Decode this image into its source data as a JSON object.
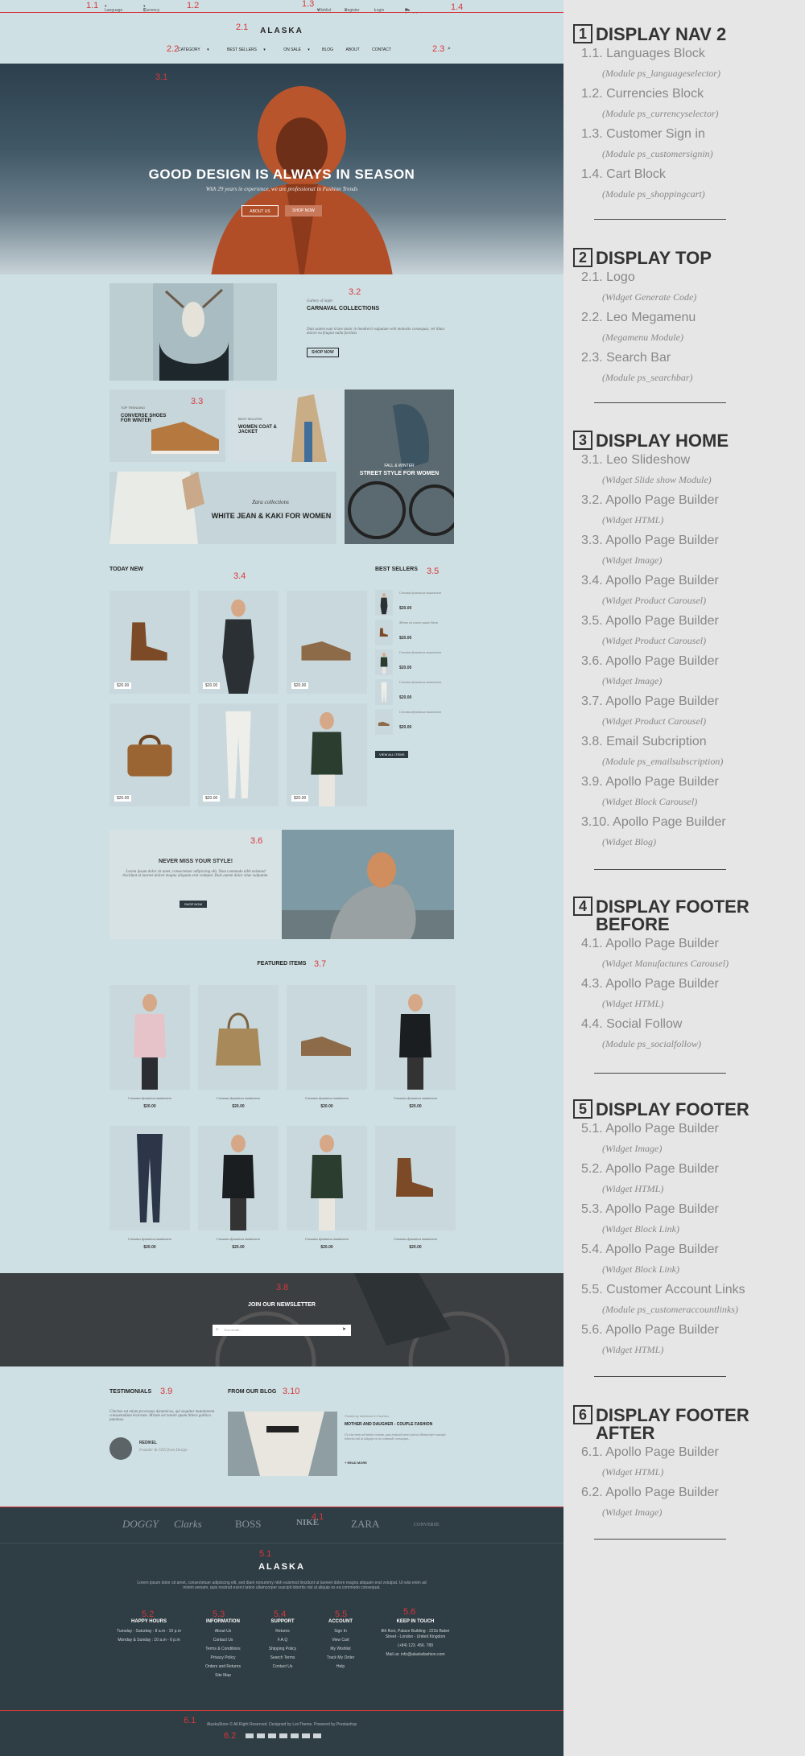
{
  "shot": {
    "tags": [
      "1.1",
      "1.2",
      "1.3",
      "1.4",
      "2.1",
      "2.2",
      "2.3",
      "3.1",
      "3.2",
      "3.3",
      "3.4",
      "3.5",
      "3.6",
      "3.7",
      "3.8",
      "3.9",
      "3.10",
      "4.1",
      "5.1",
      "5.2",
      "5.3",
      "5.4",
      "5.5",
      "5.6",
      "6.1",
      "6.2"
    ],
    "topbar": {
      "language": "Language",
      "currency": "Currency",
      "wishlist": "Wishlist",
      "register": "Register",
      "login": "Login",
      "cart": "0 item(s) - $0.00"
    },
    "logo": "ALASKA",
    "menu": [
      "CATEGORY",
      "BEST SELLERS",
      "ON SALE",
      "BLOG",
      "ABOUT",
      "CONTACT"
    ],
    "hero": {
      "title": "GOOD DESIGN IS ALWAYS IN SEASON",
      "subtitle": "With 29 years in experience, we are professional in Fashion Trends",
      "btn1": "ABOUT US",
      "btn2": "SHOP NOW"
    },
    "carnaval": {
      "kicker": "Gallery of night",
      "title": "CARNAVAL COLLECTIONS",
      "text": "Duis autem eum iriure dolor in hendrerit vulputate velit molestie consequat, vel illum dolore eu feugiat nulla facilisis",
      "btn": "SHOP NOW"
    },
    "promo": {
      "p1_kicker": "TOP TRENDING",
      "p1_title": "CONVERSE SHOES FOR WINTER",
      "p2_kicker": "BEST SELLERS",
      "p2_title": "WOMEN COAT & JACKET",
      "p3_kicker": "FALL & WINTER",
      "p3_title": "STREET STYLE FOR WOMEN",
      "p4_kicker": "Zara collections",
      "p4_title": "WHITE JEAN & KAKI FOR WOMEN"
    },
    "today_new": "TODAY NEW",
    "best_sellers": "BEST SELLERS",
    "price": "$20.00",
    "best_items": [
      "Crasmus dynamicus mutationem",
      "Mirum est notare quam littera",
      "Crasmus dynamicus mutationem",
      "Crasmus dynamicus mutationem",
      "Crasmus dynamicus mutationem"
    ],
    "view_all": "VIEW ALL ITEMS",
    "never_miss": {
      "title": "NEVER MISS YOUR STYLE!",
      "text": "Lorem ipsum dolor sit amet, consectetuer adipiscing elit. Nam commodo nibh euismod tincidunt ut laoreet dolore magna aliquam erat volutpat. Duis autem dolor vitae vulputate.",
      "btn": "SHOP NOW"
    },
    "featured": "FEATURED ITEMS",
    "feat_name": "Crassmus dynamicus mutationem",
    "newsletter": {
      "title": "JOIN OUR NEWSLETTER",
      "placeholder": "Your email..."
    },
    "testimonials": {
      "title": "TESTIMONIALS",
      "text": "Claritas est etiam processus dynamicus, qui sequitur mutationem consuetudium lectorum. Mirum est notare quam littera gothica putamus.",
      "name": "REDIKEL",
      "role": "Founder & CEO from Design"
    },
    "blog": {
      "title": "FROM OUR BLOG",
      "meta": "Posted by leotheme in Fashion",
      "post": "MOTHER AND DAUGHER - COUPLE FASHION",
      "text": "Ut wisi enim ad minim veniam, quis nostrud exerci tation ullamcorper suscipit lobortis nisl ut aliquip ex ea commodo consequat...",
      "more": "+ READ MORE"
    },
    "brands": [
      "DOGGY",
      "Clarks",
      "BOSS",
      "NIKE",
      "ZARA",
      "CONVERSE"
    ],
    "footer": {
      "logo": "ALASKA",
      "text": "Lorem ipsum dolor sit amet, consectetuer adipiscing elit, sed diam nonummy nibh euismod tincidunt ut laoreet dolore magna aliquam erat volutpat. Ut wisi enim ad minim veniam, quis nostrud exerci tation ullamcorper suscipit lobortis nisl ut aliquip ex ea commodo consequat.",
      "hours": {
        "h": "HAPPY HOURS",
        "l1": "Tuesday - Saturday : 8 a.m - 10 p.m",
        "l2": "Monday & Sunday : 10 a.m - 6 p.m"
      },
      "info": {
        "h": "INFORMATION",
        "items": [
          "About Us",
          "Contact Us",
          "Terms & Conditions",
          "Privacy Policy",
          "Orders and Returns",
          "Site Map"
        ]
      },
      "support": {
        "h": "SUPPORT",
        "items": [
          "Returns",
          "F.A.Q",
          "Shipping Policy",
          "Search Terms",
          "Contact Us"
        ]
      },
      "account": {
        "h": "ACCOUNT",
        "items": [
          "Sign In",
          "View Cart",
          "My Wishlist",
          "Track My Order",
          "Help"
        ]
      },
      "touch": {
        "h": "KEEP IN TOUCH",
        "l1": "8th floor, Palace Building - 221b Baker",
        "l2": "Street - London - United Kingdom",
        "l3": "(+84) 123. 456. 789",
        "l4": "Mail us: info@alaskafashion.com"
      },
      "copyright": "AlaskaStore © All Right Reserved. Designed by LeoTheme. Powered by Prestashop"
    }
  },
  "sidebar": [
    {
      "num": "1",
      "title": "DISPLAY NAV 2",
      "items": [
        {
          "label": "1.1. Languages Block",
          "module": "(Module ps_languageselector)"
        },
        {
          "label": "1.2. Currencies Block",
          "module": "(Module ps_currencyselector)"
        },
        {
          "label": "1.3. Customer Sign in",
          "module": "(Module ps_customersignin)"
        },
        {
          "label": "1.4. Cart Block",
          "module": "(Module ps_shoppingcart)"
        }
      ]
    },
    {
      "num": "2",
      "title": "DISPLAY TOP",
      "items": [
        {
          "label": "2.1. Logo",
          "module": "(Widget Generate Code)"
        },
        {
          "label": "2.2. Leo Megamenu",
          "module": "(Megamenu Module)"
        },
        {
          "label": "2.3. Search Bar",
          "module": "(Module ps_searchbar)"
        }
      ]
    },
    {
      "num": "3",
      "title": "DISPLAY HOME",
      "items": [
        {
          "label": "3.1. Leo Slideshow",
          "module": "(Widget Slide show Module)"
        },
        {
          "label": "3.2. Apollo Page Builder",
          "module": "(Widget HTML)"
        },
        {
          "label": "3.3. Apollo Page Builder",
          "module": "(Widget Image)"
        },
        {
          "label": "3.4. Apollo Page Builder",
          "module": "(Widget Product Carousel)"
        },
        {
          "label": "3.5. Apollo Page Builder",
          "module": "(Widget Product Carousel)"
        },
        {
          "label": "3.6. Apollo Page Builder",
          "module": "(Widget Image)"
        },
        {
          "label": "3.7. Apollo Page Builder",
          "module": "(Widget Product Carousel)"
        },
        {
          "label": "3.8. Email Subcription",
          "module": "(Module ps_emailsubscription)"
        },
        {
          "label": "3.9. Apollo Page Builder",
          "module": "(Widget Block Carousel)"
        },
        {
          "label": "3.10. Apollo Page Builder",
          "module": "(Widget Blog)"
        }
      ]
    },
    {
      "num": "4",
      "title": "DISPLAY FOOTER BEFORE",
      "items": [
        {
          "label": "4.1. Apollo Page Builder",
          "module": "(Widget Manufactures Carousel)"
        },
        {
          "label": "4.3. Apollo Page Builder",
          "module": "(Widget HTML)"
        },
        {
          "label": "4.4. Social Follow",
          "module": "(Module ps_socialfollow)"
        }
      ]
    },
    {
      "num": "5",
      "title": "DISPLAY FOOTER",
      "items": [
        {
          "label": "5.1. Apollo Page Builder",
          "module": "(Widget Image)"
        },
        {
          "label": "5.2. Apollo Page Builder",
          "module": "(Widget HTML)"
        },
        {
          "label": "5.3. Apollo Page Builder",
          "module": "(Widget Block Link)"
        },
        {
          "label": "5.4. Apollo Page Builder",
          "module": "(Widget Block Link)"
        },
        {
          "label": "5.5. Customer Account Links",
          "module": "(Module ps_customeraccountlinks)"
        },
        {
          "label": "5.6. Apollo Page Builder",
          "module": "(Widget HTML)"
        }
      ]
    },
    {
      "num": "6",
      "title": "DISPLAY FOOTER AFTER",
      "items": [
        {
          "label": "6.1. Apollo Page Builder",
          "module": "(Widget HTML)"
        },
        {
          "label": "6.2. Apollo Page Builder",
          "module": "(Widget Image)"
        }
      ]
    }
  ]
}
